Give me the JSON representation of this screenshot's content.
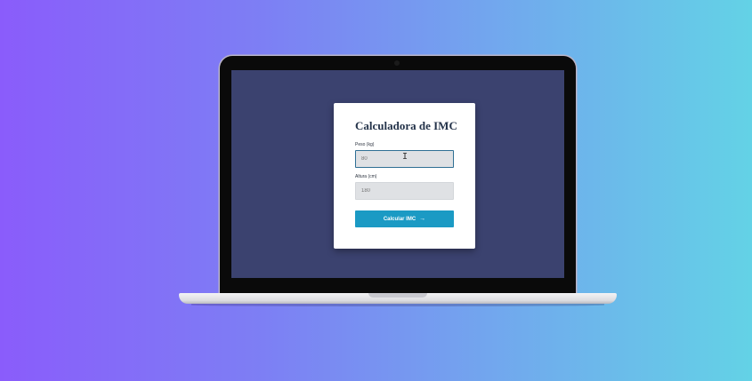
{
  "app": {
    "title": "Calculadora de IMC"
  },
  "form": {
    "weight": {
      "label": "Peso (kg)",
      "placeholder": "80",
      "value": ""
    },
    "height": {
      "label": "Altura (cm)",
      "placeholder": "180",
      "value": ""
    },
    "submit_label": "Calcular IMC",
    "submit_icon": "arrow-right-icon"
  },
  "colors": {
    "background_gradient": [
      "#8a5cfb",
      "#63d2e6"
    ],
    "screen": "#3b426f",
    "button": "#1b9ac4",
    "title": "#24334a"
  }
}
